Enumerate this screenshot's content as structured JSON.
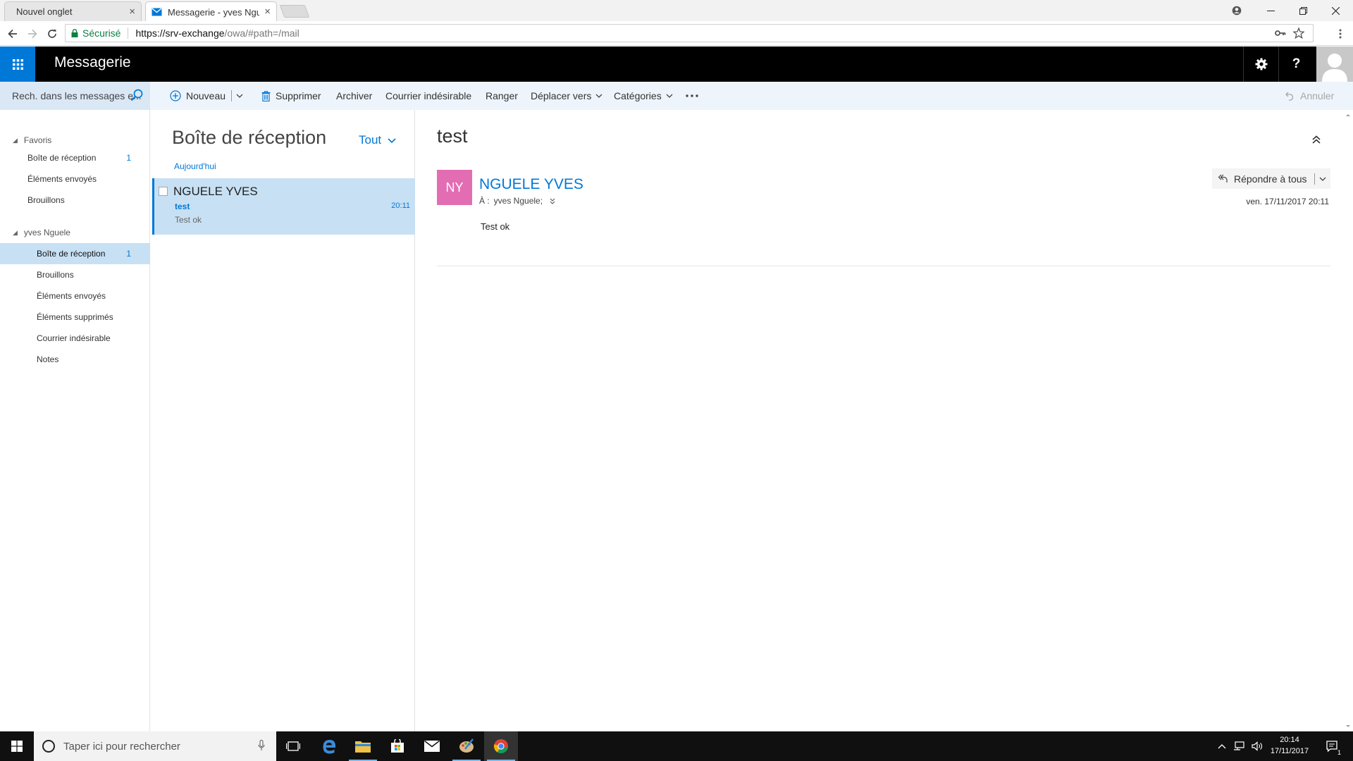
{
  "browser": {
    "tabs": [
      {
        "label": "Nouvel onglet",
        "active": false
      },
      {
        "label": "Messagerie - yves Nguele",
        "active": true
      }
    ],
    "security_label": "Sécurisé",
    "url_host": "https://srv-exchange",
    "url_path": "/owa/#path=/mail"
  },
  "header": {
    "app_title": "Messagerie"
  },
  "toolbar": {
    "search_placeholder": "Rech. dans les messages e...",
    "new_label": "Nouveau",
    "delete_label": "Supprimer",
    "archive_label": "Archiver",
    "junk_label": "Courrier indésirable",
    "sweep_label": "Ranger",
    "move_label": "Déplacer vers",
    "categories_label": "Catégories",
    "undo_label": "Annuler"
  },
  "folders": {
    "favorites_label": "Favoris",
    "favorites": [
      {
        "label": "Boîte de réception",
        "count": "1"
      },
      {
        "label": "Éléments envoyés",
        "count": ""
      },
      {
        "label": "Brouillons",
        "count": ""
      }
    ],
    "account_label": "yves Nguele",
    "account_folders": [
      {
        "label": "Boîte de réception",
        "count": "1",
        "selected": true
      },
      {
        "label": "Brouillons",
        "count": ""
      },
      {
        "label": "Éléments envoyés",
        "count": ""
      },
      {
        "label": "Éléments supprimés",
        "count": ""
      },
      {
        "label": "Courrier indésirable",
        "count": ""
      },
      {
        "label": "Notes",
        "count": ""
      }
    ]
  },
  "message_list": {
    "title": "Boîte de réception",
    "filter_label": "Tout",
    "date_group": "Aujourd'hui",
    "items": [
      {
        "sender": "NGUELE YVES",
        "subject": "test",
        "time": "20:11",
        "preview": "Test ok"
      }
    ]
  },
  "reading_pane": {
    "subject": "test",
    "avatar_initials": "NY",
    "sender": "NGUELE YVES",
    "to_label": "À :",
    "to_value": "yves Nguele;",
    "reply_all_label": "Répondre à tous",
    "date": "ven. 17/11/2017 20:11",
    "body": "Test ok"
  },
  "taskbar": {
    "search_placeholder": "Taper ici pour rechercher",
    "clock_time": "20:14",
    "clock_date": "17/11/2017",
    "notification_count": "1"
  },
  "colors": {
    "accent": "#0078d7",
    "header_bg": "#000000",
    "selection_bg": "#c7e0f4",
    "avatar_bg": "#e36db3"
  }
}
